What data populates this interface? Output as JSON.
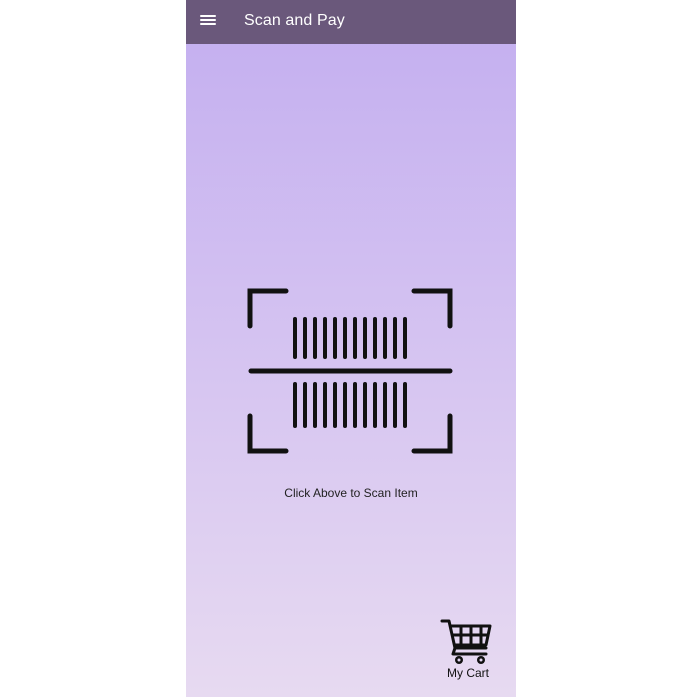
{
  "appbar": {
    "title": "Scan and Pay",
    "menu_icon": "hamburger-menu-icon",
    "background_color": "#6a587b"
  },
  "main": {
    "scan_icon": "barcode-scanner-icon",
    "scan_caption": "Click Above to Scan Item"
  },
  "cart": {
    "icon": "shopping-cart-icon",
    "label": "My Cart"
  }
}
